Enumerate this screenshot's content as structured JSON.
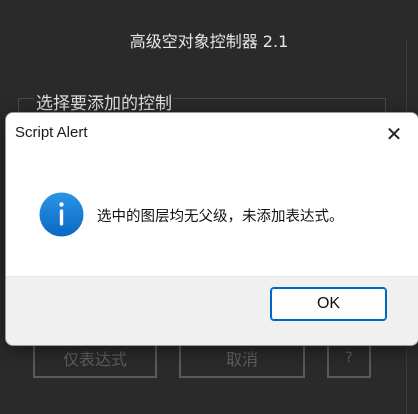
{
  "background_panel": {
    "title": "高级空对象控制器 2.1",
    "group_label": "选择要添加的控制",
    "buttons": {
      "expression_only": "仅表达式",
      "cancel": "取消",
      "help": "?"
    }
  },
  "dialog": {
    "title": "Script Alert",
    "close_glyph": "✕",
    "icon": "info-icon",
    "message": "选中的图层均无父级，未添加表达式。",
    "ok_label": "OK",
    "colors": {
      "accent": "#0067c0",
      "icon_fill": "#1a7fd4"
    }
  }
}
